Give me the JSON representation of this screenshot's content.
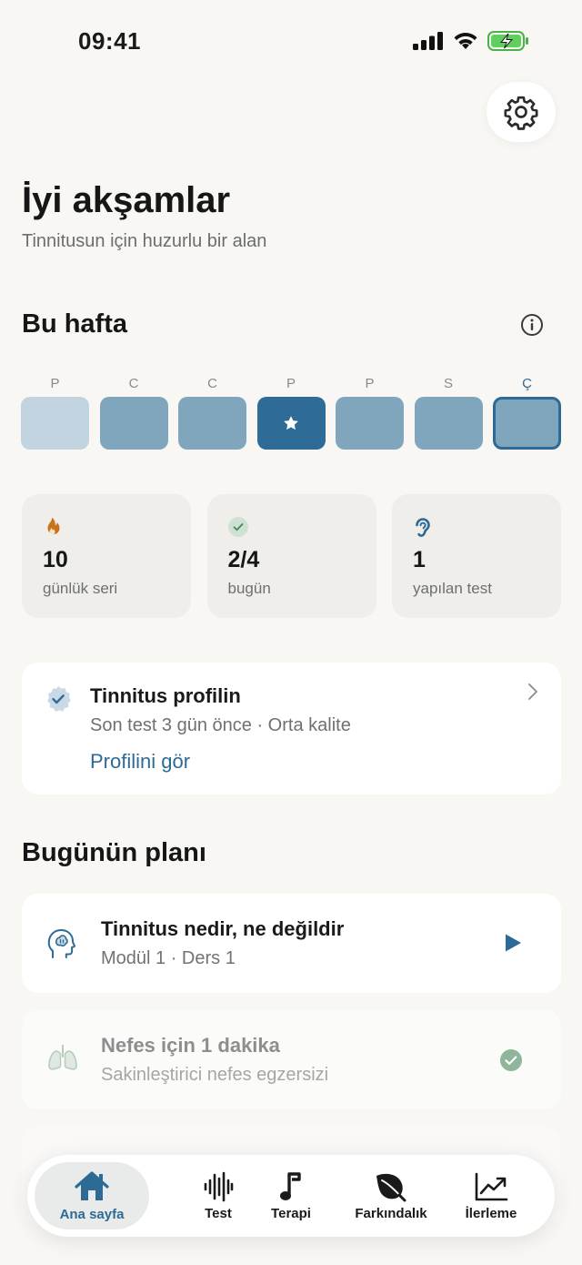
{
  "status_bar": {
    "time": "09:41"
  },
  "header": {
    "greeting": "İyi akşamlar",
    "subtitle": "Tinnitusun için huzurlu bir alan"
  },
  "week": {
    "title": "Bu hafta",
    "days": [
      {
        "letter": "P",
        "level": "light"
      },
      {
        "letter": "C",
        "level": "mid"
      },
      {
        "letter": "C",
        "level": "mid"
      },
      {
        "letter": "P",
        "level": "dark",
        "star": true
      },
      {
        "letter": "P",
        "level": "mid"
      },
      {
        "letter": "S",
        "level": "mid"
      },
      {
        "letter": "Ç",
        "level": "mid",
        "today": true
      }
    ]
  },
  "stats": [
    {
      "value": "10",
      "label": "günlük seri",
      "icon": "flame-icon"
    },
    {
      "value": "2/4",
      "label": "bugün",
      "icon": "check-circle-icon"
    },
    {
      "value": "1",
      "label": "yapılan test",
      "icon": "ear-icon"
    }
  ],
  "profile": {
    "title": "Tinnitus profilin",
    "meta": "Son test 3 gün önce · Orta kalite",
    "link": "Profilini gör"
  },
  "plan": {
    "title": "Bugünün planı",
    "items": [
      {
        "title": "Tinnitus nedir, ne değildir",
        "subtitle": "Modül 1 · Ders 1",
        "icon": "brain-head-icon",
        "action": "play-icon"
      },
      {
        "title": "Nefes için 1 dakika",
        "subtitle": "Sakinleştirici nefes egzersizi",
        "icon": "lungs-icon",
        "action": "check-icon",
        "done": true
      }
    ]
  },
  "tabs": [
    {
      "label": "Ana sayfa",
      "icon": "home-icon",
      "active": true
    },
    {
      "label": "Test",
      "icon": "waveform-icon"
    },
    {
      "label": "Terapi",
      "icon": "music-note-icon"
    },
    {
      "label": "Farkındalık",
      "icon": "leaf-icon"
    },
    {
      "label": "İlerleme",
      "icon": "chart-up-icon"
    }
  ],
  "colors": {
    "accent": "#2d6a95",
    "day_light": "#c2d4df",
    "day_mid": "#7fa6bc",
    "day_dark": "#2e6b97",
    "background": "#f8f7f4",
    "flame": "#c7741f",
    "done_green": "#8fb59a"
  }
}
